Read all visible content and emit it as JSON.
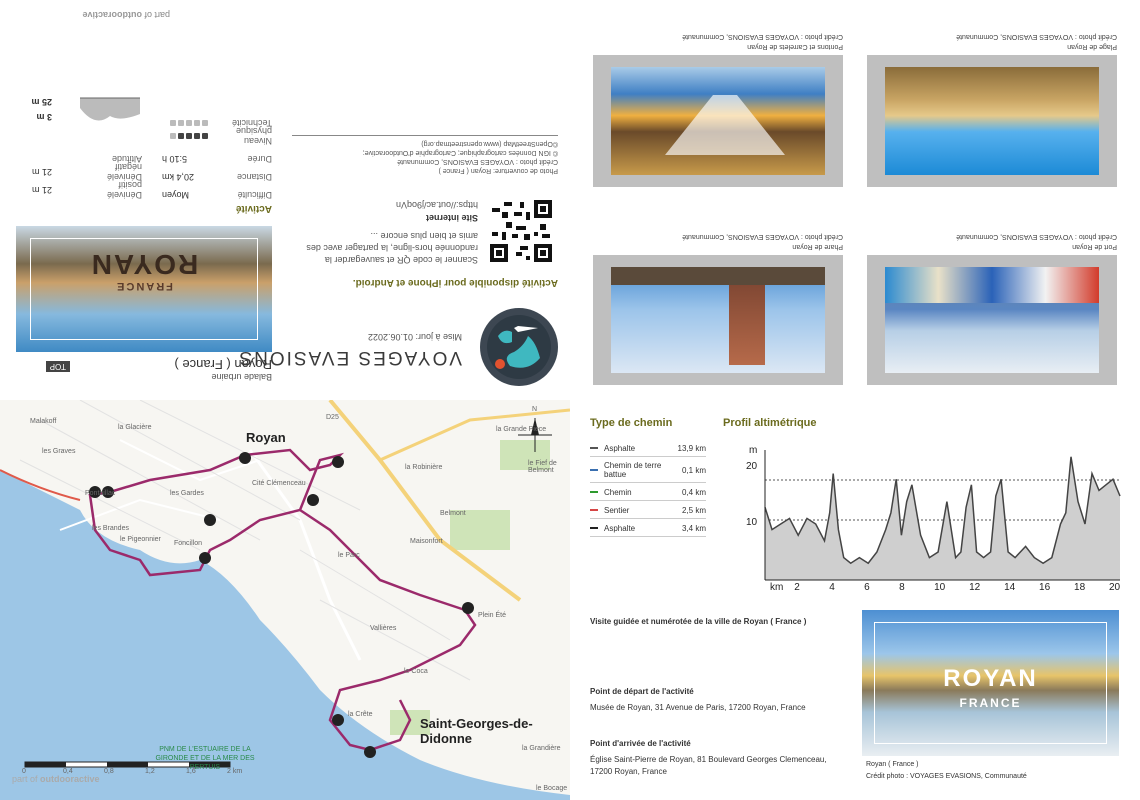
{
  "cover": {
    "brand": "VOYAGES EVASIONS",
    "updated": "Mise à jour: 01.06.2022",
    "app_title": "Activité disponible pour iPhone et Android.",
    "app_text": "Scanner le code QR et sauvegarder la randonnée hors-ligne, la partager avec des amis et bien plus encore ...",
    "site_label": "Site internet",
    "site_url": "https://out.ac/j9oqVn",
    "credits_1": "Photo de couverture: Royan ( France )",
    "credits_2": "Crédit photo : VOYAGES EVASIONS, Communauté",
    "credits_3": "© IGN Données cartographique; Cartographie d'Outdooractive;",
    "credits_4": "©OpenStreetMap (www.openstreetmap.org)",
    "top_badge": "TOP",
    "place_title": "Royan ( France )",
    "category": "Balade urbaine",
    "cover_title": "ROYAN",
    "cover_subtitle": "FRANCE",
    "activity_label": "Activité",
    "part_of": "part of",
    "outdooractive": "outdooractive"
  },
  "stats": [
    {
      "label": "Difficulté",
      "value": "Moyen"
    },
    {
      "label": "Distance",
      "value": "20,4 km"
    },
    {
      "label": "Durée",
      "value": "5:10 h"
    },
    {
      "label": "Niveau physique",
      "value": "",
      "level": 4
    },
    {
      "label": "Technicité",
      "value": "",
      "level": 0
    },
    {
      "label": "Dénivelé positif",
      "value": "21 m"
    },
    {
      "label": "Altitude",
      "value": ""
    },
    {
      "label": "Dénivelé négatif",
      "value": "21 m"
    }
  ],
  "altitude_range": {
    "max": "25 m",
    "min": "3 m"
  },
  "photos": [
    {
      "title": "Pontons et Carrelets de Royan",
      "credit": "Crédit photo : VOYAGES EVASIONS, Communauté"
    },
    {
      "title": "Plage de Royan",
      "credit": "Crédit photo : VOYAGES EVASIONS, Communauté"
    },
    {
      "title": "Phare de Royan",
      "credit": "Crédit photo : VOYAGES EVASIONS, Communauté"
    },
    {
      "title": "Port de Royan",
      "credit": "Crédit photo : VOYAGES EVASIONS, Communauté"
    }
  ],
  "map": {
    "labels": [
      "Royan",
      "Saint-Georges-de-Didonne",
      "Malakoff",
      "la Glacière",
      "les Graves",
      "le Pigeonnier",
      "Foncillon",
      "les Gardes",
      "Cité Clémenceau",
      "le Parc",
      "Maisonfort",
      "Belmont",
      "la Robinière",
      "Vallières",
      "Plein Été",
      "le Coca",
      "la Crête",
      "Pontaillac",
      "la Grande Pièce",
      "le Fief de Belmont",
      "la Grandière",
      "le Bocage",
      "les Brandes",
      "D25",
      "N"
    ],
    "scale_labels": [
      "0",
      "0,4",
      "0,8",
      "1,2",
      "1,6",
      "2 km"
    ],
    "pnm": "PNM DE L'ESTUAIRE DE LA GIRONDE ET DE LA MER DES PERTUIS",
    "part_of": "part of",
    "outdooractive": "outdooractive"
  },
  "route": {
    "path_type_title": "Type de chemin",
    "profile_title": "Profil altimétrique",
    "segments": [
      {
        "name": "Asphalte",
        "km": "13,9 km",
        "color": "#555555"
      },
      {
        "name": "Chemin de terre battue",
        "km": "0,1 km",
        "color": "#3a6fb0"
      },
      {
        "name": "Chemin",
        "km": "0,4 km",
        "color": "#2e9a2e"
      },
      {
        "name": "Sentier",
        "km": "2,5 km",
        "color": "#d64545"
      },
      {
        "name": "Asphalte",
        "km": "3,4 km",
        "color": "#222222"
      }
    ],
    "desc": "Visite guidée et numérotée de la ville de Royan ( France )",
    "start_label": "Point de départ de l'activité",
    "start": "Musée de Royan, 31 Avenue de Paris, 17200 Royan, France",
    "end_label": "Point d'arrivée de l'activité",
    "end": "Église Saint-Pierre de Royan, 81 Boulevard Georges Clemenceau, 17200 Royan, France",
    "photo_caption": "Royan ( France )",
    "photo_credit": "Crédit photo : VOYAGES EVASIONS, Communauté",
    "photo_title": "ROYAN",
    "photo_subtitle": "FRANCE"
  },
  "chart_data": {
    "type": "area",
    "ylabel": "m",
    "xlabel": "km",
    "x_ticks": [
      "2",
      "4",
      "6",
      "8",
      "10",
      "12",
      "14",
      "16",
      "18",
      "20"
    ],
    "y_ticks": [
      "10",
      "20"
    ],
    "xlim": [
      0.1,
      20.4
    ],
    "ylim": [
      0,
      25
    ],
    "x": [
      0.1,
      0.5,
      1,
      1.5,
      2,
      2.5,
      3,
      3.5,
      3.8,
      4,
      4.3,
      4.6,
      5,
      5.5,
      6,
      6.5,
      7,
      7.3,
      7.6,
      7.9,
      8.2,
      8.5,
      9,
      9.5,
      10,
      10.5,
      11,
      11.3,
      11.6,
      11.9,
      12.2,
      12.6,
      13,
      13.3,
      13.6,
      14,
      14.4,
      15,
      15.5,
      16,
      16.5,
      17,
      17.3,
      17.6,
      18,
      18.4,
      18.8,
      19.2,
      19.6,
      20,
      20.4
    ],
    "values": [
      13,
      9,
      10,
      11,
      8,
      11,
      10,
      7,
      12,
      19,
      9,
      4,
      3,
      4,
      3,
      5,
      9,
      12,
      18,
      8,
      14,
      17,
      8,
      4,
      5,
      14,
      4,
      5,
      13,
      17,
      5,
      4,
      5,
      15,
      18,
      5,
      4,
      6,
      4,
      3,
      4,
      10,
      12,
      22,
      14,
      10,
      19,
      16,
      17,
      18,
      15
    ]
  }
}
